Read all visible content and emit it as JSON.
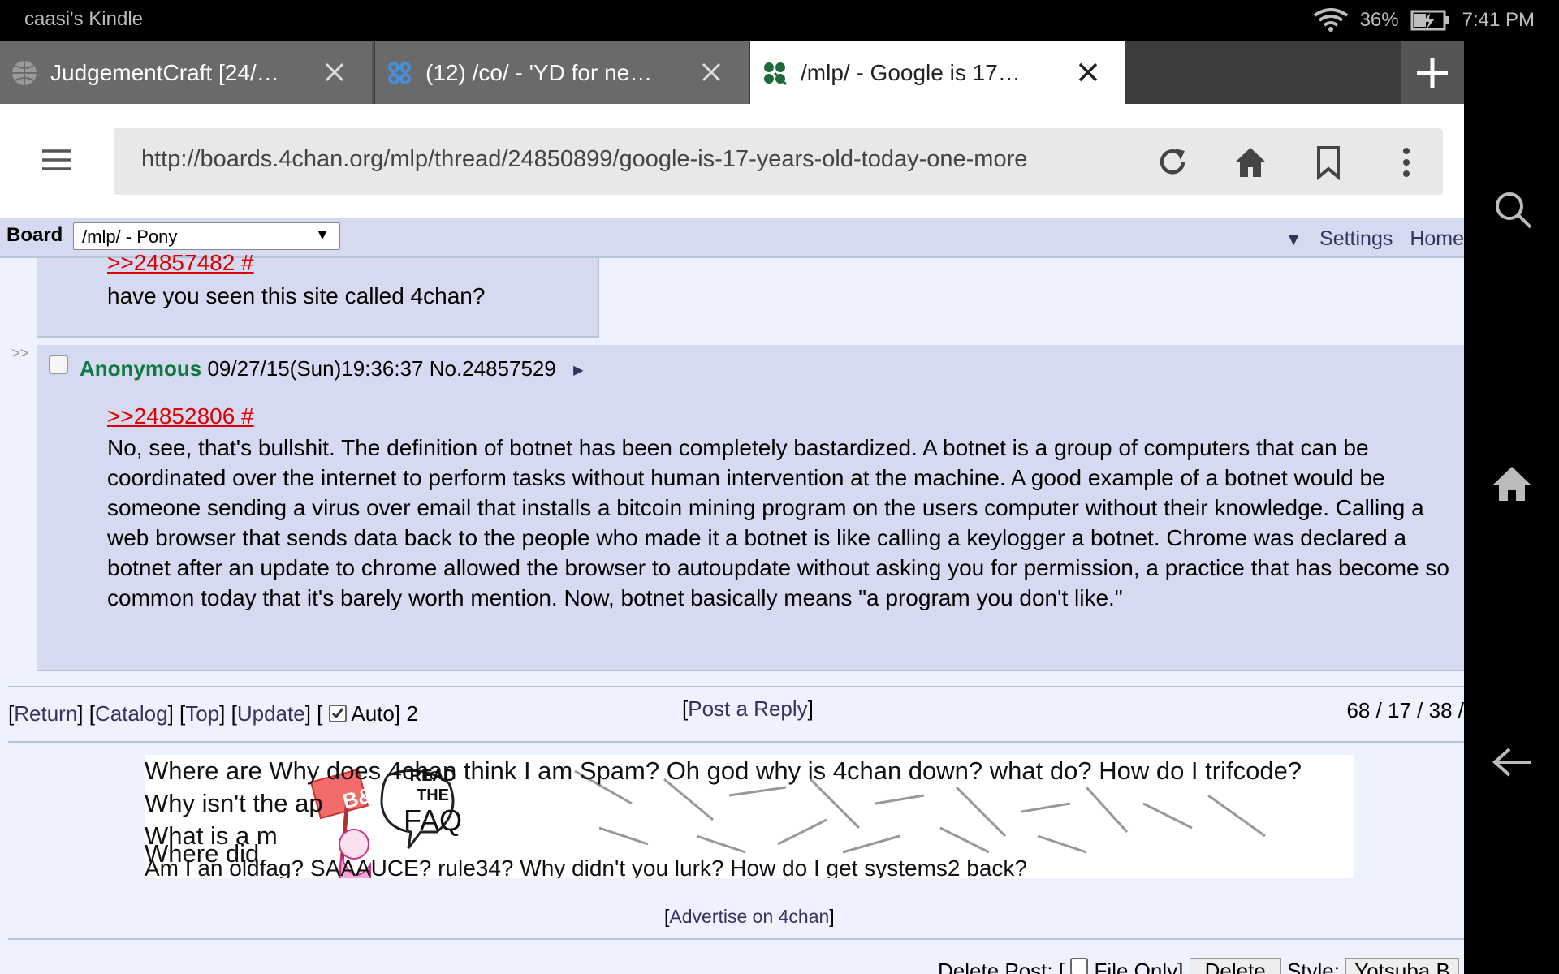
{
  "status_bar": {
    "device_name": "caasi's Kindle",
    "battery": "36%",
    "time": "7:41 PM"
  },
  "tabs": [
    {
      "title": "JudgementCraft [24/…",
      "state": "inactive",
      "icon": "globe-icon"
    },
    {
      "title": "(12) /co/ - 'YD for ne…",
      "state": "inactive",
      "icon": "clover-icon"
    },
    {
      "title": "/mlp/ - Google is 17…",
      "state": "active",
      "icon": "clover-icon"
    }
  ],
  "toolbar": {
    "url": "http://boards.4chan.org/mlp/thread/24850899/google-is-17-years-old-today-one-more"
  },
  "board_bar": {
    "label": "Board",
    "selected": "/mlp/ - Pony",
    "settings": "Settings",
    "home": "Home"
  },
  "posts": [
    {
      "quote": ">>24857482 #",
      "message": "have you seen this site called 4chan?"
    },
    {
      "side_arrows": ">>",
      "name": "Anonymous",
      "datetime": "09/27/15(Sun)19:36:37",
      "number": "No.24857529",
      "quote": ">>24852806 #",
      "message": "No, see, that's bullshit. The definition of botnet has been completely bastardized. A botnet is a group of computers that can be coordinated over the internet to perform tasks without human intervention at the machine. A good example of a botnet would be someone sending a virus over email that installs a bitcoin mining program on the users computer without their knowledge. Calling a web browser that sends data back to the people who made it a botnet is like calling a keylogger a botnet. Chrome was declared a botnet after an update to chrome allowed the browser to autoupdate without asking you for permission, a practice that has become so common today that it's barely worth mention. Now, botnet basically means \"a program you don't like.\""
    }
  ],
  "thread_nav": {
    "return": "Return",
    "catalog": "Catalog",
    "top": "Top",
    "update": "Update",
    "auto": "Auto",
    "auto_count": "2",
    "post_reply": "Post a Reply",
    "stats": "68 / 17 / 38 /"
  },
  "banner": {
    "lines": [
      "Where are Why does 4chan think I am Spam? Oh god why is 4chan down? what do? How do I trifcode?",
      "Why isn't the ap",
      "What is a m",
      "Where did",
      "Am I an oldfag? SAAAUCE? rule34? Why didn't you lurk? How do I get systems2 back?"
    ],
    "sign": "B&",
    "bubble": [
      "READ",
      "THE",
      "FAQ"
    ]
  },
  "advertise": "Advertise on 4chan",
  "bottom": {
    "delete_post": "Delete Post:",
    "file_only": "File Only",
    "delete": "Delete",
    "style": "Style:",
    "style_value": "Yotsuba B"
  }
}
